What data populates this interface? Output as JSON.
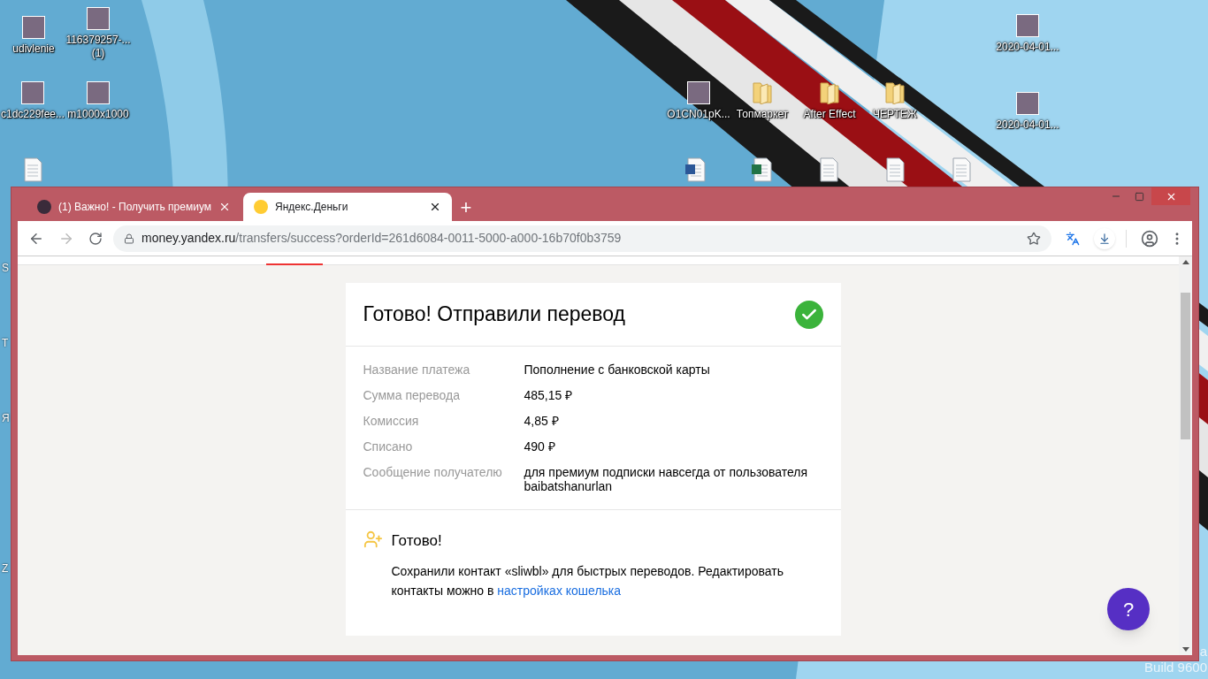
{
  "desktop": {
    "icons": [
      {
        "kind": "photo",
        "label": "udivlenie"
      },
      {
        "kind": "photo",
        "label": "116379257-... (1)"
      },
      {
        "kind": "photo",
        "label": "c1dc229fee..."
      },
      {
        "kind": "photo",
        "label": "m1000x1000"
      },
      {
        "kind": "file"
      },
      {
        "kind": "photo",
        "label": "O1CN01pK..."
      },
      {
        "kind": "folder",
        "label": "Топмаркет"
      },
      {
        "kind": "folder",
        "label": "After Effect"
      },
      {
        "kind": "folder",
        "label": "ЧЕРТЕЖ"
      },
      {
        "kind": "photo",
        "label": "2020-04-01..."
      },
      {
        "kind": "photo",
        "label": "2020-04-01..."
      },
      {
        "kind": "word"
      },
      {
        "kind": "excel"
      },
      {
        "kind": "file"
      },
      {
        "kind": "file"
      },
      {
        "kind": "file"
      }
    ],
    "edge_labels": [
      "S",
      "T",
      "Я",
      "Z"
    ],
    "watermark_lines": [
      "a",
      "Build 9600"
    ]
  },
  "browser": {
    "tabs": [
      {
        "title": "(1) Важно! - Получить премиум",
        "selected": false
      },
      {
        "title": "Яндекс.Деньги",
        "selected": true
      }
    ],
    "new_tab": "+",
    "url_host": "money.yandex.ru",
    "url_path": "/transfers/success?orderId=261d6084-0011-5000-a000-16b70f0b3759"
  },
  "page": {
    "title": "Готово! Отправили перевод",
    "details": [
      {
        "label": "Название платежа",
        "value": "Пополнение с банковской карты"
      },
      {
        "label": "Сумма перевода",
        "value": "485,15 ₽"
      },
      {
        "label": "Комиссия",
        "value": "4,85 ₽"
      },
      {
        "label": "Списано",
        "value": "490 ₽"
      },
      {
        "label": "Сообщение получателю",
        "value": "для премиум подписки навсегда от пользователя baibatshanurlan"
      }
    ],
    "contact": {
      "title": "Готово!",
      "text": "Сохранили контакт «sliwbl» для быстрых переводов. Редактировать контакты можно в",
      "link": "настройках кошелька"
    },
    "help_button": "?"
  }
}
